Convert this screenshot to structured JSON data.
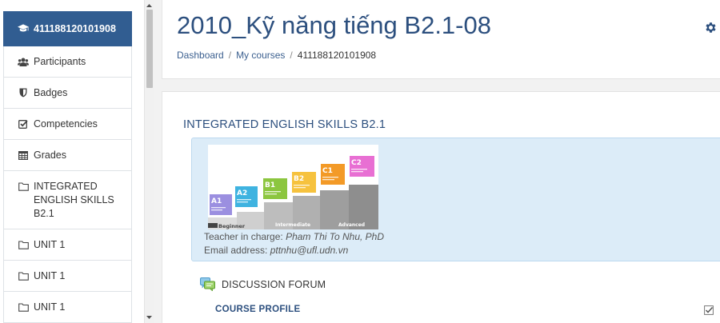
{
  "sidebar": {
    "course_short": "411188120101908",
    "items": [
      {
        "label": "Participants",
        "icon": "users-icon"
      },
      {
        "label": "Badges",
        "icon": "shield-icon"
      },
      {
        "label": "Competencies",
        "icon": "checkbox-icon"
      },
      {
        "label": "Grades",
        "icon": "table-icon"
      },
      {
        "label": "INTEGRATED ENGLISH SKILLS B2.1",
        "icon": "folder-icon"
      },
      {
        "label": "UNIT 1",
        "icon": "folder-icon"
      },
      {
        "label": "UNIT 1",
        "icon": "folder-icon"
      },
      {
        "label": "UNIT 1",
        "icon": "folder-icon"
      }
    ]
  },
  "header": {
    "title": "2010_Kỹ năng tiếng B2.1-08",
    "breadcrumb": [
      "Dashboard",
      "My courses",
      "411188120101908"
    ]
  },
  "content": {
    "section_title": "INTEGRATED ENGLISH SKILLS B2.1",
    "banner": {
      "levels": [
        "A1",
        "A2",
        "B1",
        "B2",
        "C1",
        "C2"
      ],
      "labels": [
        "Beginner",
        "Intermediate",
        "Advanced"
      ]
    },
    "teacher_label": "Teacher in charge: ",
    "teacher_name": "Pham Thi To Nhu, PhD",
    "email_label": "Email address: ",
    "email_value": "pttnhu@ufl.udn.vn",
    "forum_label": "DISCUSSION FORUM",
    "course_profile": "COURSE PROFILE"
  },
  "colors": {
    "accent": "#315d91",
    "title": "#2c4f7e",
    "summary_bg": "#dcecf8"
  }
}
